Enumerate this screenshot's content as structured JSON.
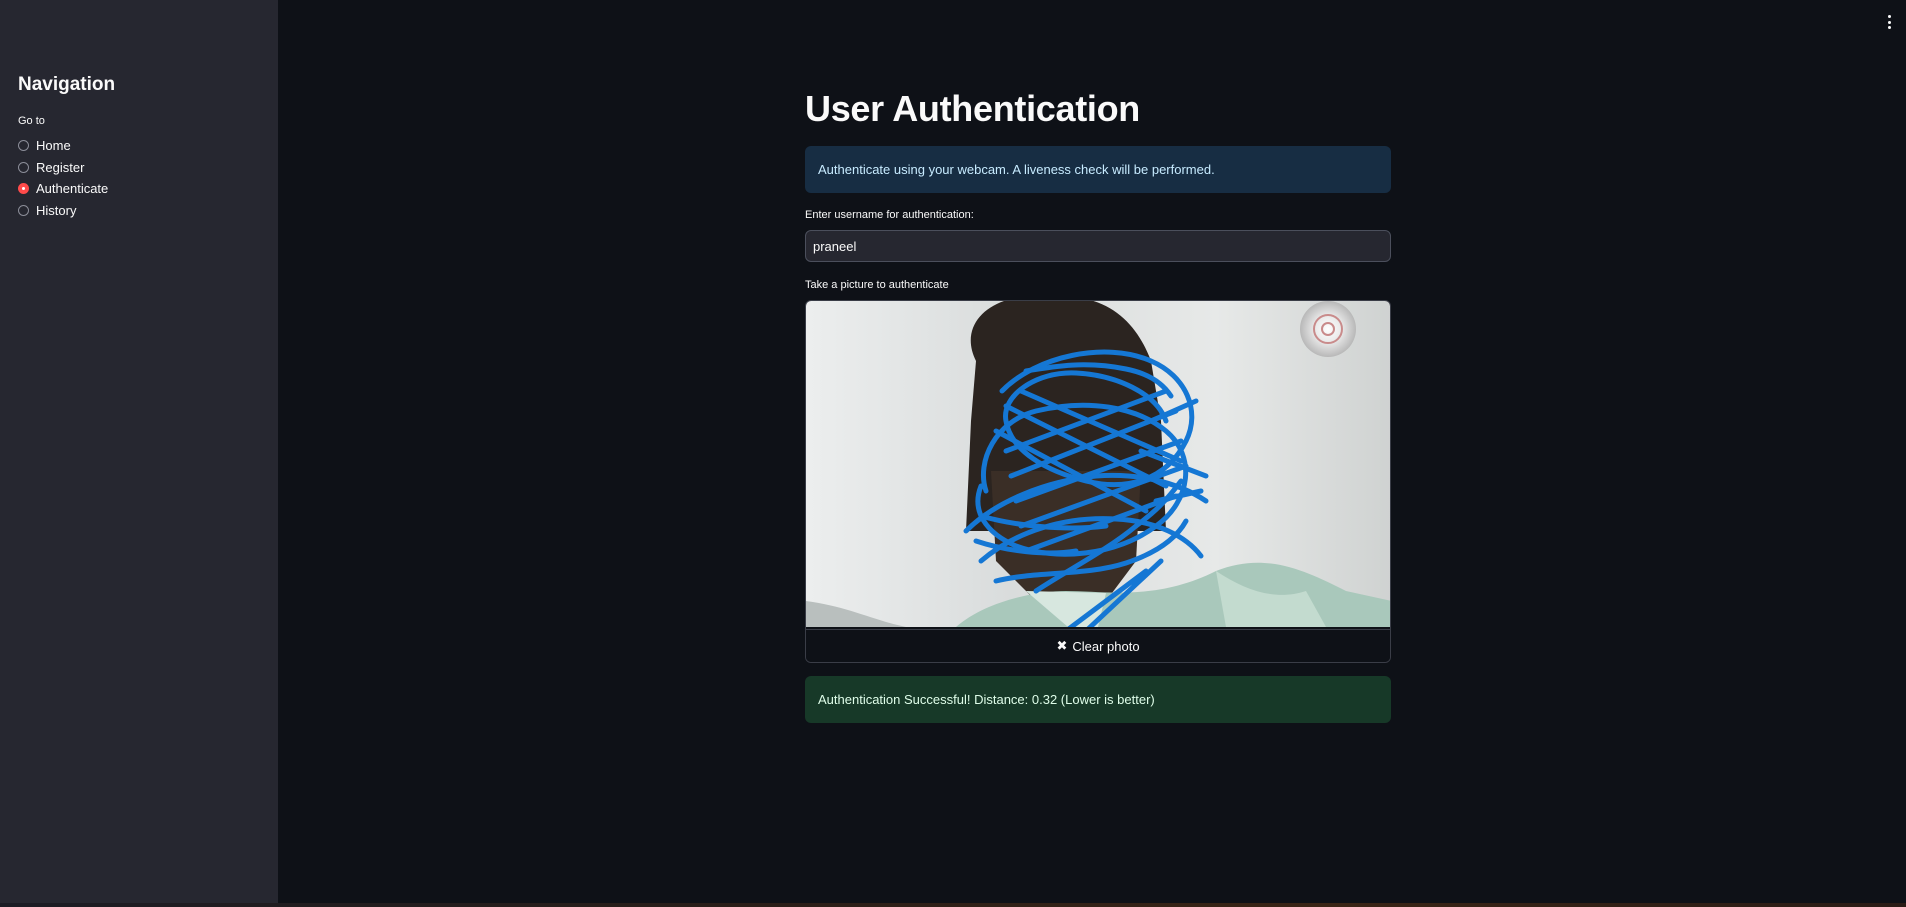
{
  "sidebar": {
    "title": "Navigation",
    "goto_label": "Go to",
    "options": [
      {
        "label": "Home",
        "selected": false
      },
      {
        "label": "Register",
        "selected": false
      },
      {
        "label": "Authenticate",
        "selected": true
      },
      {
        "label": "History",
        "selected": false
      }
    ]
  },
  "main": {
    "title": "User Authentication",
    "info": "Authenticate using your webcam. A liveness check will be performed.",
    "username_label": "Enter username for authentication:",
    "username_value": "praneel",
    "camera_label": "Take a picture to authenticate",
    "clear_button": "Clear photo",
    "success_message": "Authentication Successful! Distance: 0.32 (Lower is better)"
  },
  "icons": {
    "menu": "vertical-ellipsis-icon",
    "clear": "close-icon"
  },
  "colors": {
    "accent": "#ff4b4b",
    "info_bg": "#172d43",
    "success_bg": "#173928",
    "scribble": "#1577d4"
  }
}
